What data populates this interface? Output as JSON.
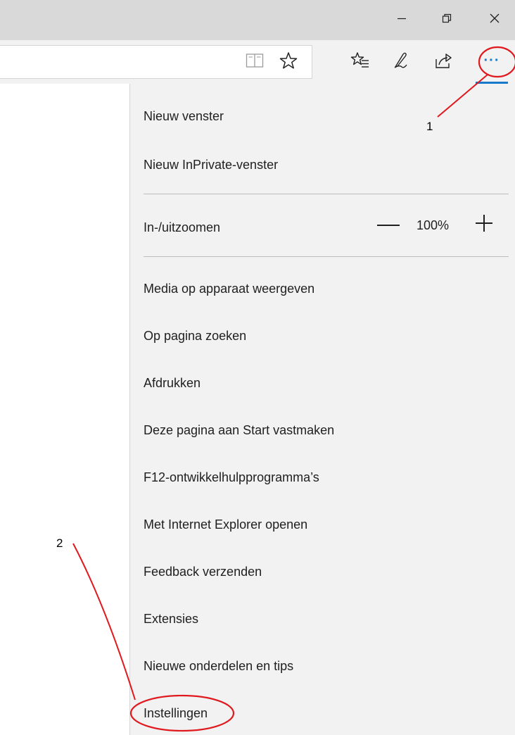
{
  "window": {
    "minimize_icon": "minimize-icon",
    "restore_icon": "restore-icon",
    "close_icon": "close-icon"
  },
  "toolbar": {
    "icons": [
      "reading-view-icon",
      "favorite-star-icon",
      "hub-icon",
      "web-note-icon",
      "share-icon",
      "more-icon"
    ],
    "more_label": "···",
    "accent_color": "#1979ca"
  },
  "menu": {
    "items_top": [
      {
        "label": "Nieuw venster"
      },
      {
        "label": "Nieuw InPrivate-venster"
      }
    ],
    "zoom": {
      "label": "In-/uitzoomen",
      "value": "100%"
    },
    "items_bottom": [
      {
        "label": "Media op apparaat weergeven"
      },
      {
        "label": "Op pagina zoeken"
      },
      {
        "label": "Afdrukken"
      },
      {
        "label": "Deze pagina aan Start vastmaken"
      },
      {
        "label": "F12-ontwikkelhulpprogramma’s"
      },
      {
        "label": "Met Internet Explorer openen"
      },
      {
        "label": "Feedback verzenden"
      },
      {
        "label": "Extensies"
      },
      {
        "label": "Nieuwe onderdelen en tips"
      },
      {
        "label": "Instellingen"
      }
    ]
  },
  "annotations": {
    "callout_1": "1",
    "callout_2": "2",
    "color": "#e0191e"
  }
}
